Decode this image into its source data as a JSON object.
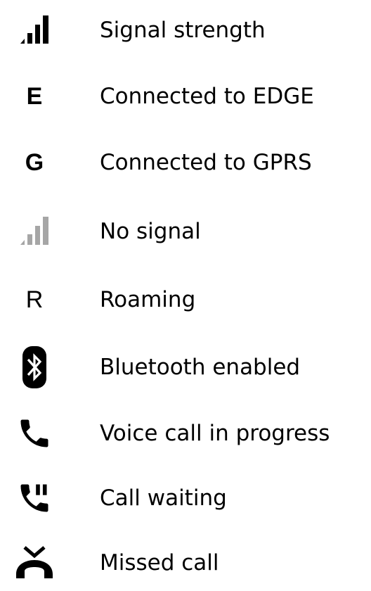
{
  "colors": {
    "text": "#000000",
    "icon": "#000000",
    "icon_muted": "#a6a6a6",
    "background": "#ffffff"
  },
  "items": [
    {
      "icon": "signal-strength-icon",
      "label": "Signal strength"
    },
    {
      "icon": "edge-icon",
      "glyph": "E",
      "label": "Connected to EDGE"
    },
    {
      "icon": "gprs-icon",
      "glyph": "G",
      "label": "Connected to GPRS"
    },
    {
      "icon": "no-signal-icon",
      "label": "No signal"
    },
    {
      "icon": "roaming-icon",
      "glyph": "R",
      "label": "Roaming"
    },
    {
      "icon": "bluetooth-icon",
      "label": "Bluetooth enabled"
    },
    {
      "icon": "phone-icon",
      "label": "Voice call in progress"
    },
    {
      "icon": "call-waiting-icon",
      "label": "Call waiting"
    },
    {
      "icon": "missed-call-icon",
      "label": "Missed call"
    }
  ]
}
